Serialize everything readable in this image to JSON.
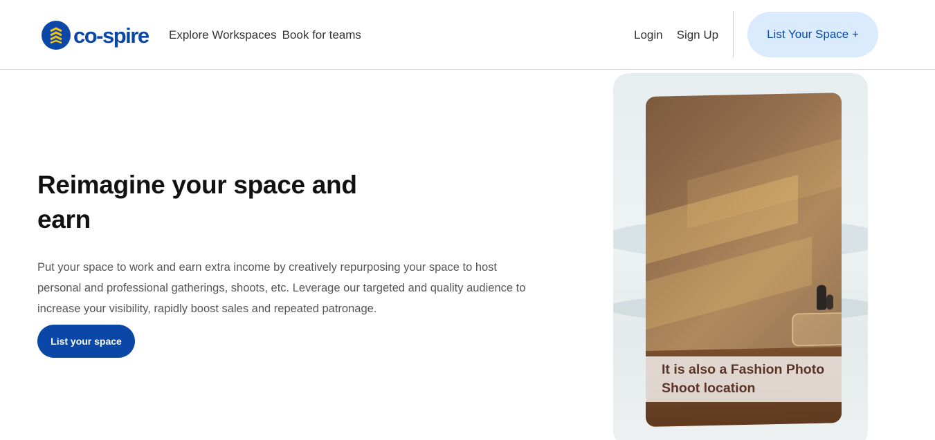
{
  "brand": {
    "name": "co-spire",
    "color": "#0b47a6"
  },
  "nav": {
    "explore": "Explore Workspaces",
    "teams": "Book for teams",
    "login": "Login",
    "signup": "Sign Up",
    "list_space": "List Your Space +"
  },
  "hero": {
    "title": "Reimagine your space and earn",
    "description": "Put your space to work and earn extra income by creatively repurposing your space to host personal and professional gatherings, shoots, etc. Leverage our targeted and quality audience to increase your visibility, rapidly boost sales and repeated patronage.",
    "button": "List your space"
  },
  "card": {
    "caption": "It is also a Fashion Photo Shoot location"
  },
  "colors": {
    "primary": "#0b47a6",
    "cta_light": "#d9ebfc",
    "caption_text": "#5b3527"
  }
}
